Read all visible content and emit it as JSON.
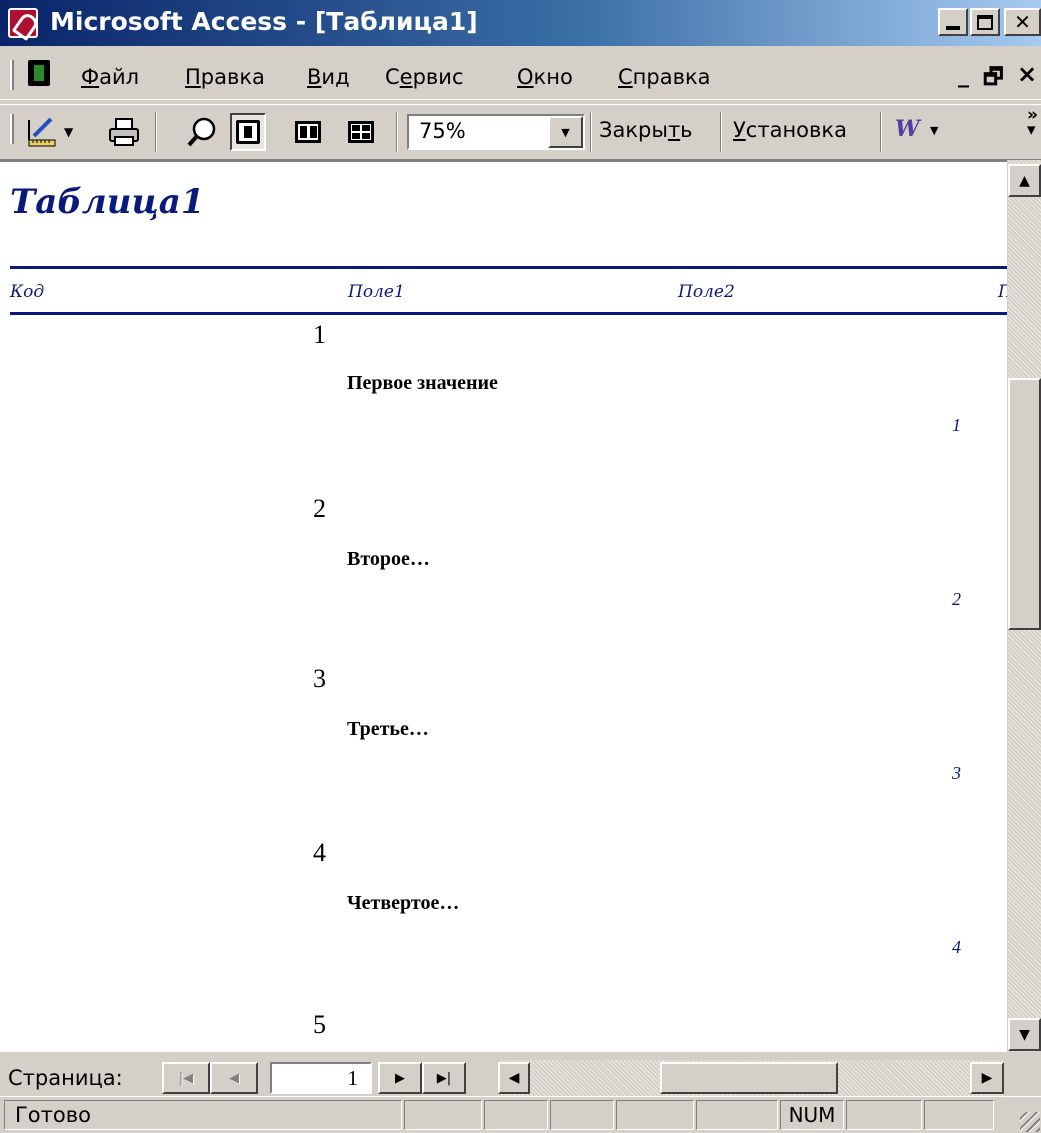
{
  "window": {
    "title": "Microsoft Access - [Таблица1]"
  },
  "menu": {
    "items": [
      {
        "underline": "Ф",
        "rest": "айл"
      },
      {
        "underline": "П",
        "rest": "равка"
      },
      {
        "underline": "В",
        "rest": "ид"
      },
      {
        "pre": "С",
        "underline": "е",
        "rest": "рвис"
      },
      {
        "underline": "О",
        "rest": "кно"
      },
      {
        "underline": "С",
        "rest": "правка"
      }
    ]
  },
  "toolbar": {
    "zoom_value": "75%",
    "close_pre": "Закры",
    "close_underline": "т",
    "close_post": "ь",
    "setup_underline": "У",
    "setup_post": "становка",
    "word_icon_glyph": "W"
  },
  "report": {
    "title": "Таблица1",
    "columns": [
      "Код",
      "Поле1",
      "Поле2",
      "П"
    ],
    "rows": [
      {
        "code": "1",
        "field1": "Первое значение",
        "field2": "1"
      },
      {
        "code": "2",
        "field1": "Второе…",
        "field2": "2"
      },
      {
        "code": "3",
        "field1": "Третье…",
        "field2": "3"
      },
      {
        "code": "4",
        "field1": "Четвертое…",
        "field2": "4"
      },
      {
        "code": "5"
      }
    ]
  },
  "navigation": {
    "page_label": "Страница:",
    "current_page": "1"
  },
  "status": {
    "text": "Готово",
    "num": "NUM"
  },
  "colors": {
    "titlebar_start": "#0a246a",
    "report_accent": "#0a1a7a",
    "chrome": "#d4d0c8"
  }
}
